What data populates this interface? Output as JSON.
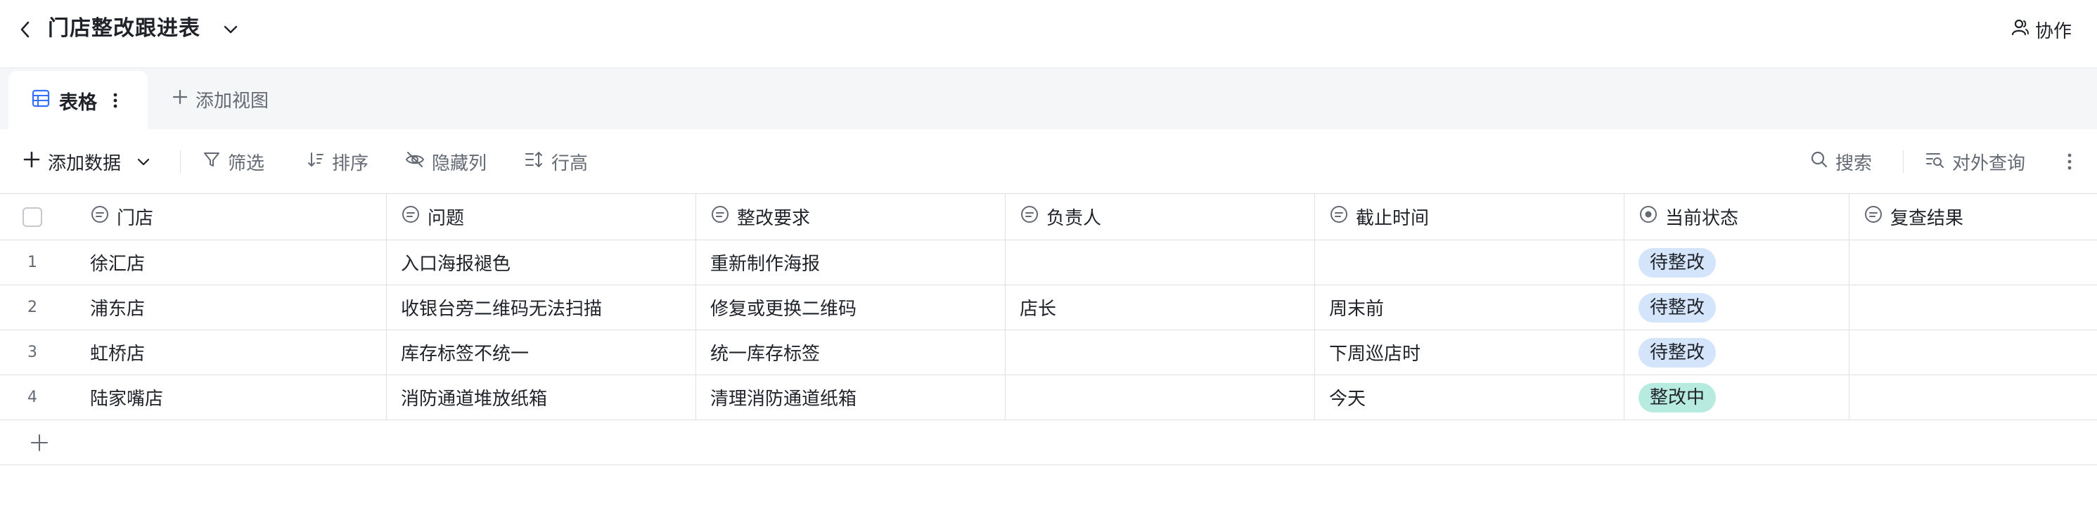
{
  "header": {
    "title": "门店整改跟进表",
    "collab_label": "协作"
  },
  "tabs": {
    "active_label": "表格",
    "add_view_label": "添加视图"
  },
  "toolbar": {
    "add_data_label": "添加数据",
    "filter_label": "筛选",
    "sort_label": "排序",
    "hide_cols_label": "隐藏列",
    "row_height_label": "行高",
    "search_label": "搜索",
    "external_query_label": "对外查询"
  },
  "table": {
    "columns": [
      "门店",
      "问题",
      "整改要求",
      "负责人",
      "截止时间",
      "当前状态",
      "复查结果"
    ],
    "rows": [
      {
        "index": "1",
        "store": "徐汇店",
        "issue": "入口海报褪色",
        "requirement": "重新制作海报",
        "owner": "",
        "deadline": "",
        "status": "待整改",
        "review": ""
      },
      {
        "index": "2",
        "store": "浦东店",
        "issue": "收银台旁二维码无法扫描",
        "requirement": "修复或更换二维码",
        "owner": "店长",
        "deadline": "周末前",
        "status": "待整改",
        "review": ""
      },
      {
        "index": "3",
        "store": "虹桥店",
        "issue": "库存标签不统一",
        "requirement": "统一库存标签",
        "owner": "",
        "deadline": "下周巡店时",
        "status": "待整改",
        "review": ""
      },
      {
        "index": "4",
        "store": "陆家嘴店",
        "issue": "消防通道堆放纸箱",
        "requirement": "清理消防通道纸箱",
        "owner": "",
        "deadline": "今天",
        "status": "整改中",
        "review": ""
      }
    ]
  },
  "colors": {
    "pending_badge": "#d4e4fb",
    "in_progress_badge": "#b8ebe0",
    "accent": "#3370ff",
    "border": "#dee0e3"
  },
  "icons": {
    "text_field": "chat-bubble-icon",
    "status_field": "radio-dot-icon",
    "table_view": "grid-table-icon"
  }
}
